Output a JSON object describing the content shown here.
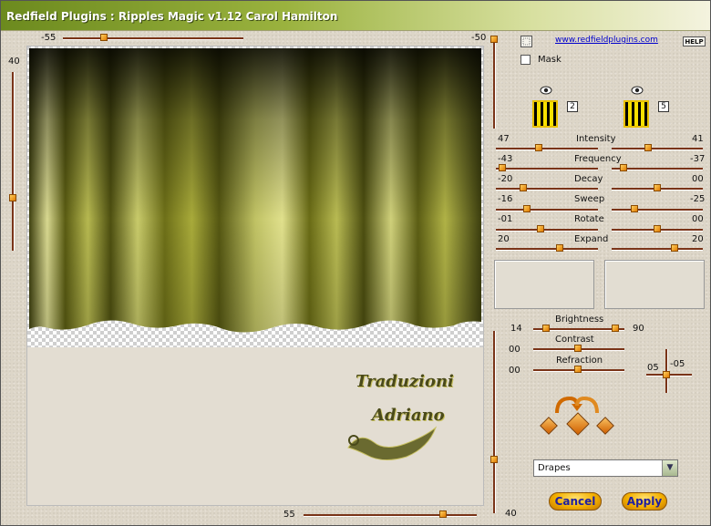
{
  "window": {
    "title": "Redfield Plugins : Ripples Magic v1.12   Carol Hamilton"
  },
  "header": {
    "link": "www.redfieldplugins.com",
    "help": "HELP"
  },
  "preview": {
    "top_slider_value": "-55",
    "left_slider_value": "40",
    "bottom_slider_value": "55",
    "right_top_value": "-50",
    "right_bottom_value": "40",
    "watermark_line1": "Traduzioni",
    "watermark_line2": "Adriano"
  },
  "mask": {
    "label": "Mask"
  },
  "swatches": {
    "left_num": "2",
    "right_num": "5"
  },
  "params": [
    {
      "label": "Intensity",
      "left": "47",
      "right": "41"
    },
    {
      "label": "Frequency",
      "left": "-43",
      "right": "-37"
    },
    {
      "label": "Decay",
      "left": "-20",
      "right": "00"
    },
    {
      "label": "Sweep",
      "left": "-16",
      "right": "-25"
    },
    {
      "label": "Rotate",
      "left": "-01",
      "right": "00"
    },
    {
      "label": "Expand",
      "left": "20",
      "right": "20"
    }
  ],
  "lighting": {
    "brightness": {
      "label": "Brightness",
      "left": "14",
      "right": "90"
    },
    "contrast": {
      "label": "Contrast",
      "value": "00"
    },
    "refraction": {
      "label": "Refraction",
      "value": "00"
    },
    "cross_left": "05",
    "cross_right": "-05"
  },
  "preset": {
    "selected": "Drapes"
  },
  "buttons": {
    "cancel": "Cancel",
    "apply": "Apply"
  },
  "colors": {
    "accent": "#f3b000",
    "curtain": "#a8ac2a",
    "title_bar": "#8aa233"
  }
}
